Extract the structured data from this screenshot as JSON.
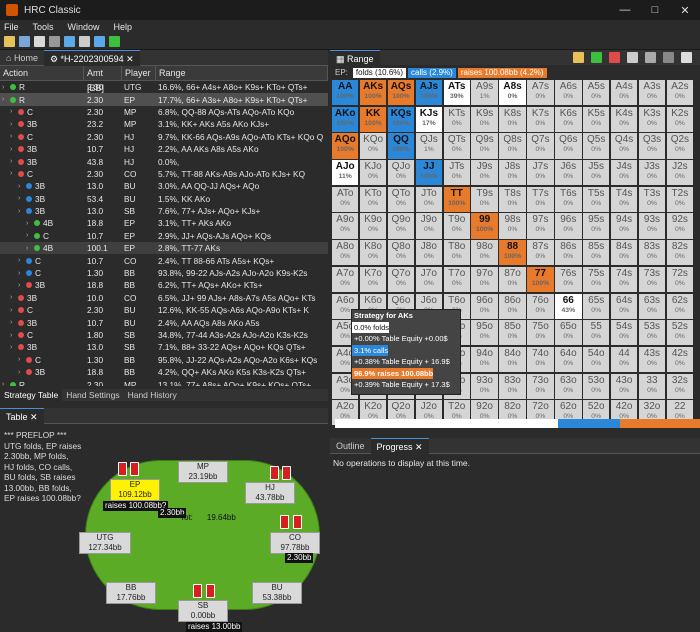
{
  "app": {
    "title": "HRC Classic"
  },
  "menu": [
    "File",
    "Tools",
    "Window",
    "Help"
  ],
  "left_tabs": {
    "home": "Home",
    "session": "*H-2202300594"
  },
  "tree_headers": {
    "action": "Action",
    "amt": "Amt [BB]",
    "player": "Player",
    "range": "Range"
  },
  "tree_rows": [
    {
      "a": "R",
      "c": "#3fbf3f",
      "amt": "2.30",
      "pl": "UTG",
      "rg": "16.6%, 66+ A4s+ A8o+ K9s+ KTo+ QTs+"
    },
    {
      "a": "R",
      "c": "#3fbf3f",
      "amt": "2.30",
      "pl": "EP",
      "rg": "17.7%, 66+ A3s+ A8o+ K9s+ KTo+ QTs+"
    },
    {
      "a": "C",
      "c": "#e04b4b",
      "amt": "2.30",
      "pl": "MP",
      "rg": "6.8%, QQ-88 AQs-ATs AQo-ATo KQo"
    },
    {
      "a": "3B",
      "c": "#e04b4b",
      "amt": "23.2",
      "pl": "MP",
      "rg": "3.1%, KK+ AKs A5s AKo KJs+"
    },
    {
      "a": "C",
      "c": "#e04b4b",
      "amt": "2.30",
      "pl": "HJ",
      "rg": "9.7%, KK-66 AQs-A9s AQo-ATo KTs+ KQo Q"
    },
    {
      "a": "3B",
      "c": "#e04b4b",
      "amt": "10.7",
      "pl": "HJ",
      "rg": "2.2%, AA AKs A8s A5s AKo"
    },
    {
      "a": "3B",
      "c": "#e04b4b",
      "amt": "43.8",
      "pl": "HJ",
      "rg": "0.0%,"
    },
    {
      "a": "C",
      "c": "#e04b4b",
      "amt": "2.30",
      "pl": "CO",
      "rg": "5.7%, TT-88 AKs-A9s AJo-ATo KJs+ KQ"
    },
    {
      "a": "3B",
      "c": "#2b88d8",
      "amt": "13.0",
      "pl": "BU",
      "rg": "3.0%, AA QQ-JJ AQs+ AQo"
    },
    {
      "a": "3B",
      "c": "#2b88d8",
      "amt": "53.4",
      "pl": "BU",
      "rg": "1.5%, KK AKo"
    },
    {
      "a": "3B",
      "c": "#2b88d8",
      "amt": "13.0",
      "pl": "SB",
      "rg": "7.6%, 77+ AJs+ AQo+ KJs+"
    },
    {
      "a": "4B",
      "c": "#3fbf3f",
      "amt": "18.8",
      "pl": "EP",
      "rg": "3.1%, TT+ AKs AKo"
    },
    {
      "a": "C",
      "c": "#3fbf3f",
      "amt": "10.7",
      "pl": "EP",
      "rg": "2.9%, JJ+ AQs-AJs AQo+ KQs"
    },
    {
      "a": "4B",
      "c": "#3fbf3f",
      "amt": "100.1",
      "pl": "EP",
      "rg": "2.8%, TT-77 AKs"
    },
    {
      "a": "C",
      "c": "#2b88d8",
      "amt": "10.7",
      "pl": "CO",
      "rg": "2.4%, TT 88-66 ATs A5s+ KQs+"
    },
    {
      "a": "C",
      "c": "#2b88d8",
      "amt": "1.30",
      "pl": "BB",
      "rg": "93.8%, 99-22 AJs-A2s AJo-A2o K9s-K2s"
    },
    {
      "a": "3B",
      "c": "#e04b4b",
      "amt": "18.8",
      "pl": "BB",
      "rg": "6.2%, TT+ AQs+ AKo+ KTs+"
    },
    {
      "a": "3B",
      "c": "#e04b4b",
      "amt": "10.0",
      "pl": "CO",
      "rg": "6.5%, JJ+ 99 AJs+ A8s-A7s A5s AQo+ KTs"
    },
    {
      "a": "C",
      "c": "#e04b4b",
      "amt": "2.30",
      "pl": "BU",
      "rg": "12.6%, KK-55 AQs-A6s AQo-A9o KTs+ K"
    },
    {
      "a": "3B",
      "c": "#e04b4b",
      "amt": "10.7",
      "pl": "BU",
      "rg": "2.4%, AA AQs A8s AKo A5s"
    },
    {
      "a": "C",
      "c": "#e04b4b",
      "amt": "1.80",
      "pl": "SB",
      "rg": "34.8%, 77-44 A3s-A2s AJo-A2o K3s-K2s"
    },
    {
      "a": "3B",
      "c": "#e04b4b",
      "amt": "13.0",
      "pl": "SB",
      "rg": "7.1%, 88+ 33-22 AQs+ AQo+ KQs QTs+"
    },
    {
      "a": "C",
      "c": "#e04b4b",
      "amt": "1.30",
      "pl": "BB",
      "rg": "95.8%, JJ-22 AQs-A2s AQo-A2o K6s+ KQs"
    },
    {
      "a": "3B",
      "c": "#e04b4b",
      "amt": "18.8",
      "pl": "BB",
      "rg": "4.2%, QQ+ AKs AKo K5s K3s-K2s QTs+"
    },
    {
      "a": "R",
      "c": "#3fbf3f",
      "amt": "2.30",
      "pl": "MP",
      "rg": "13.1%, 77+ A8s+ AQo+ K9s+ KQs+ QTs+"
    }
  ],
  "bottom_tabs": [
    "Strategy Table",
    "Hand Settings",
    "Hand History"
  ],
  "table_tab": "Table",
  "history": [
    "*** PREFLOP ***",
    "UTG folds, EP raises",
    "2.30bb, MP folds,",
    "HJ folds, CO calls,",
    "BU folds, SB raises",
    "13.00bb, BB folds,",
    "EP raises 100.08bb?"
  ],
  "seats": {
    "mp": {
      "name": "MP",
      "stack": "23.19bb"
    },
    "hj": {
      "name": "HJ",
      "stack": "43.78bb"
    },
    "ep": {
      "name": "EP",
      "stack": "109.12bb",
      "action": "raises 100.08bb?"
    },
    "utg": {
      "name": "UTG",
      "stack": "127.34bb"
    },
    "co": {
      "name": "CO",
      "stack": "97.78bb",
      "bet": "2.30bb"
    },
    "bb": {
      "name": "BB",
      "stack": "17.76bb"
    },
    "sb": {
      "name": "SB",
      "stack": "0.00bb",
      "action": "raises 13.00bb"
    },
    "bu": {
      "name": "BU",
      "stack": "53.38bb"
    }
  },
  "pot": {
    "bet": "2.30bb",
    "label": "Tot:",
    "total": "19.64bb"
  },
  "range_tab": "Range",
  "legend": {
    "folds": "folds (10.6%)",
    "calls": "calls (2.9%)",
    "raises": "raises 100.08bb (4.2%)"
  },
  "colors": {
    "blue": "#2b88d8",
    "orange": "#e87a2b",
    "green": "#3fbf3f",
    "red": "#e04b4b"
  },
  "popup": {
    "title": "Strategy for AKs",
    "l1": "0.0% folds",
    "l2": "+0.00% Table Equity +0.00$",
    "l3": "3.1% calls",
    "l4": "+0.38% Table Equity + 16.9$",
    "l5": "96.9% raises 100.08bb",
    "l6": "+0.39% Table Equity + 17.3$"
  },
  "outline_tabs": {
    "outline": "Outline",
    "progress": "Progress"
  },
  "progress_msg": "No operations to display at this time."
}
